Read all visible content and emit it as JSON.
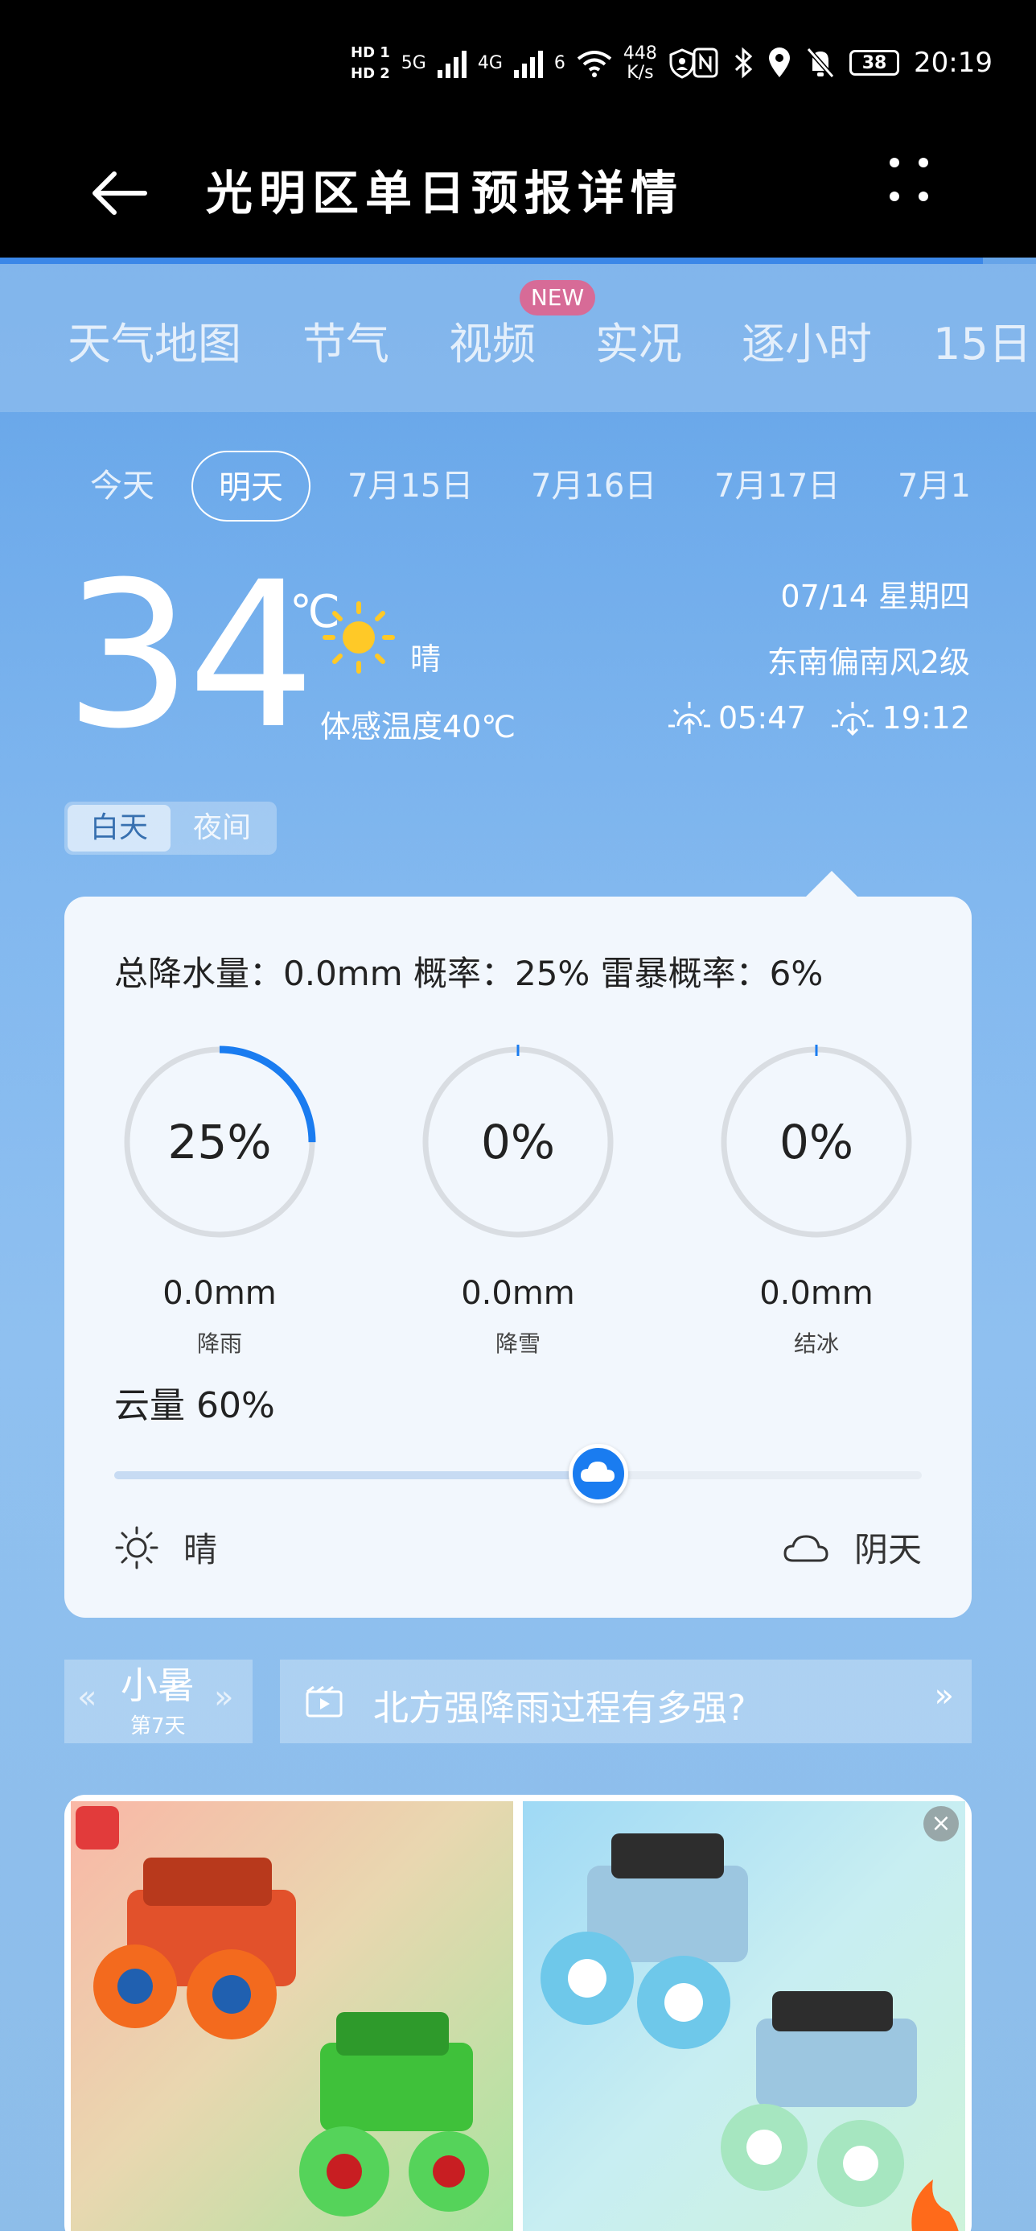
{
  "status_bar": {
    "hd1": "HD 1",
    "hd2": "HD 2",
    "sig1": "5G",
    "sig2": "4G",
    "wifi_num": "6",
    "speed_value": "448",
    "speed_unit": "K/s",
    "battery": "38",
    "time": "20:19"
  },
  "header": {
    "title": "光明区单日预报详情"
  },
  "nav_tabs": [
    {
      "label": "天气地图"
    },
    {
      "label": "节气"
    },
    {
      "label": "视频",
      "badge": "NEW"
    },
    {
      "label": "实况"
    },
    {
      "label": "逐小时"
    },
    {
      "label": "15日"
    }
  ],
  "day_tabs": [
    {
      "label": "今天"
    },
    {
      "label": "明天",
      "active": true
    },
    {
      "label": "7月15日"
    },
    {
      "label": "7月16日"
    },
    {
      "label": "7月17日"
    },
    {
      "label": "7月1"
    }
  ],
  "current": {
    "temp": "34",
    "unit": "℃",
    "condition": "晴",
    "feels_like": "体感温度40℃",
    "date": "07/14 星期四",
    "wind": "东南偏南风2级",
    "sunrise": "05:47",
    "sunset": "19:12"
  },
  "day_night": {
    "day": "白天",
    "night": "夜间"
  },
  "precip_card": {
    "summary": "总降水量：0.0mm  概率：25%  雷暴概率：6%",
    "rings": [
      {
        "pct": "25%",
        "fraction": 0.25,
        "amount": "0.0mm",
        "label": "降雨"
      },
      {
        "pct": "0%",
        "fraction": 0,
        "amount": "0.0mm",
        "label": "降雪"
      },
      {
        "pct": "0%",
        "fraction": 0,
        "amount": "0.0mm",
        "label": "结冰"
      }
    ],
    "cloud": "云量 60%",
    "cloud_fraction": 0.6,
    "scale_left": "晴",
    "scale_right": "阴天"
  },
  "solar_term": {
    "name": "小暑",
    "sub": "第7天"
  },
  "news": {
    "text": "北方强降雨过程有多强?"
  },
  "colors": {
    "accent": "#1a7cf0",
    "ring_track": "#d9dde2"
  }
}
